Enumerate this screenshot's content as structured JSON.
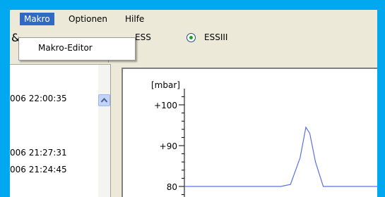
{
  "menu": {
    "items": [
      "Makro",
      "Optionen",
      "Hilfe"
    ],
    "active": "Makro",
    "dropdown": [
      "Makro-Editor"
    ]
  },
  "toolbar": {
    "glyph": "&",
    "radio_options": [
      {
        "label": "ESS",
        "checked": false
      },
      {
        "label": "ESSIII",
        "checked": true
      }
    ]
  },
  "log": {
    "timestamps": [
      "006 22:00:35",
      "006 21:27:31",
      "006 21:24:45"
    ]
  },
  "colors": {
    "desktop": "#00a8f0",
    "menu_highlight": "#316ac5",
    "series": "#5b6fe6"
  },
  "chart_data": {
    "type": "line",
    "ylabel": "[mbar]",
    "y_ticks": [
      {
        "value": 100,
        "label": "+100"
      },
      {
        "value": 90,
        "label": "+90"
      },
      {
        "value": 80,
        "label": "80"
      }
    ],
    "series": [
      {
        "x": [
          0,
          0.5,
          0.55,
          0.6,
          0.63,
          0.65,
          0.68,
          0.72,
          1.0
        ],
        "y": [
          80,
          80,
          80.5,
          87,
          94.5,
          93,
          86,
          80,
          80
        ]
      }
    ]
  }
}
